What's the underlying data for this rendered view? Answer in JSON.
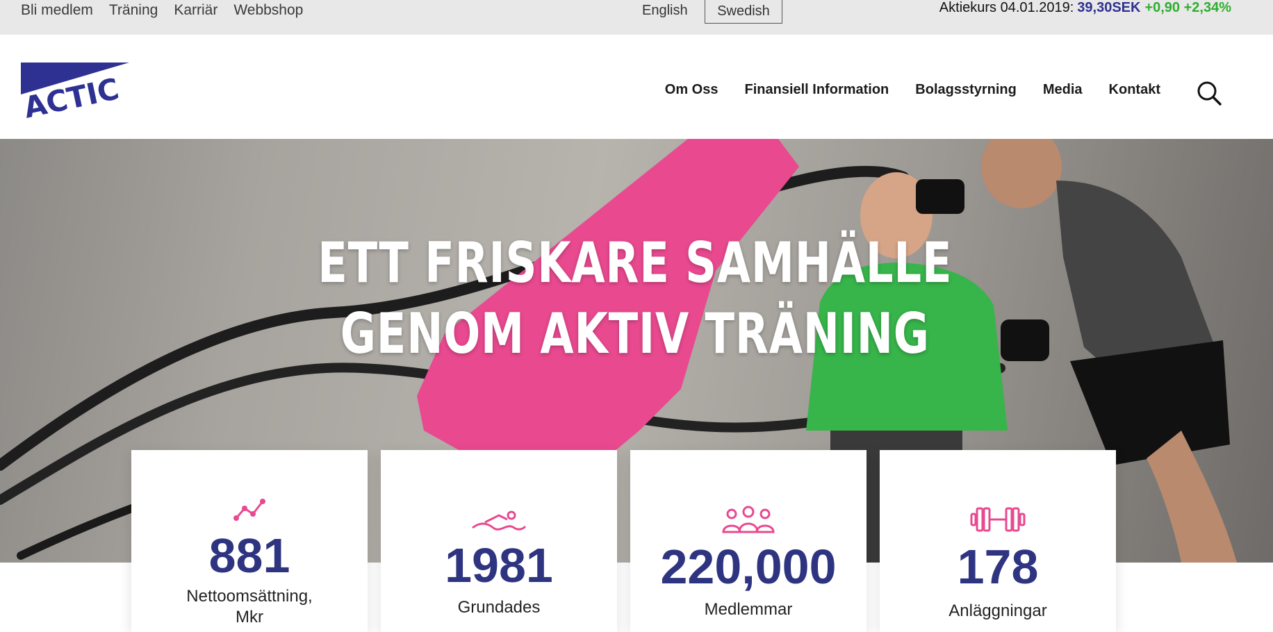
{
  "topbar": {
    "links": [
      "Bli medlem",
      "Träning",
      "Karriär",
      "Webbshop"
    ],
    "lang_english": "English",
    "lang_swedish": "Swedish",
    "stock_label": "Aktiekurs 04.01.2019:",
    "stock_price": "39,30SEK",
    "stock_change": "+0,90 +2,34%"
  },
  "header": {
    "logo_text": "ACTIC",
    "nav": [
      "Om Oss",
      "Finansiell Information",
      "Bolagsstyrning",
      "Media",
      "Kontakt"
    ]
  },
  "hero": {
    "headline_line1": "ETT FRISKARE SAMHÄLLE",
    "headline_line2": "GENOM AKTIV TRÄNING"
  },
  "stats": [
    {
      "icon": "line-chart-icon",
      "value": "881",
      "caption_line1": "Nettoomsättning,",
      "caption_line2": "Mkr"
    },
    {
      "icon": "swimmer-icon",
      "value": "1981",
      "caption_line1": "Grundades",
      "caption_line2": ""
    },
    {
      "icon": "members-icon",
      "value": "220,000",
      "caption_line1": "Medlemmar",
      "caption_line2": ""
    },
    {
      "icon": "dumbbell-icon",
      "value": "178",
      "caption_line1": "Anläggningar",
      "caption_line2": ""
    }
  ],
  "colors": {
    "brand_blue": "#2e3192",
    "accent_pink": "#e8498f",
    "stock_green": "#2fae2f",
    "topbar_bg": "#e8e8e8"
  }
}
